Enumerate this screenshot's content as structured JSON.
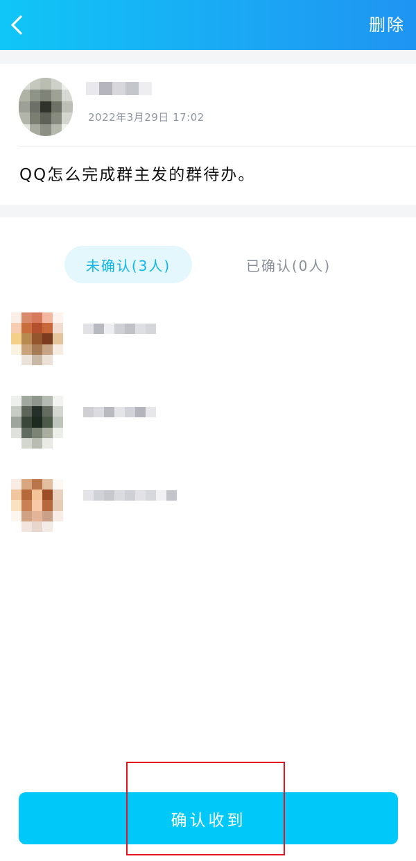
{
  "header": {
    "back_icon": "chevron-left-icon",
    "delete_label": "删除",
    "background": "#1ba7f4"
  },
  "post": {
    "author_name": "",
    "time": "2022年3月29日  17:02",
    "content": "QQ怎么完成群主发的群待办。"
  },
  "tabs": {
    "unconfirmed_label": "未确认(3人)",
    "confirmed_label": "已确认(0人)"
  },
  "members": [
    {
      "name": ""
    },
    {
      "name": ""
    },
    {
      "name": ""
    }
  ],
  "confirm_button": {
    "label": "确认收到",
    "color": "#00c9f9"
  },
  "highlight_color": "#e3141b"
}
